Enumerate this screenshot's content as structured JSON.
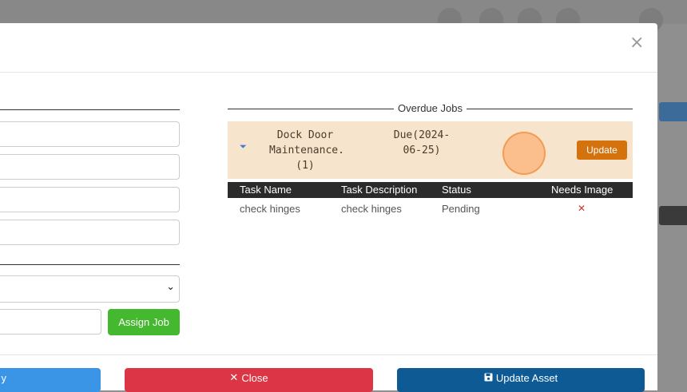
{
  "modal": {
    "close_glyph": "×"
  },
  "left_form": {
    "assign_job_label": "Assign Job",
    "select_chevron": "⌄"
  },
  "overdue_jobs": {
    "title": "Overdue Jobs",
    "job": {
      "name": "Dock Door Maintenance.(1)",
      "due": "Due(2024-06-25)",
      "update_label": "Update",
      "caret": "⏷"
    },
    "columns": [
      "Task Name",
      "Task Description",
      "Status",
      "Needs Image"
    ],
    "tasks": [
      {
        "name": "check hinges",
        "description": "check hinges",
        "status": "Pending",
        "needs_image": "✕"
      }
    ]
  },
  "footer": {
    "left_button_label": "y",
    "close_button_label": "Close",
    "close_icon": "✕",
    "update_asset_label": "Update Asset",
    "update_asset_icon": "💾"
  },
  "colors": {
    "job_row_bg": "#f7e4cc",
    "update_btn": "#d4720d",
    "assign_btn": "#44b82e",
    "close_btn": "#dc3545",
    "update_asset_btn": "#0d5a94",
    "left_btn": "#3b95e6",
    "table_header": "#2b2b2b"
  }
}
